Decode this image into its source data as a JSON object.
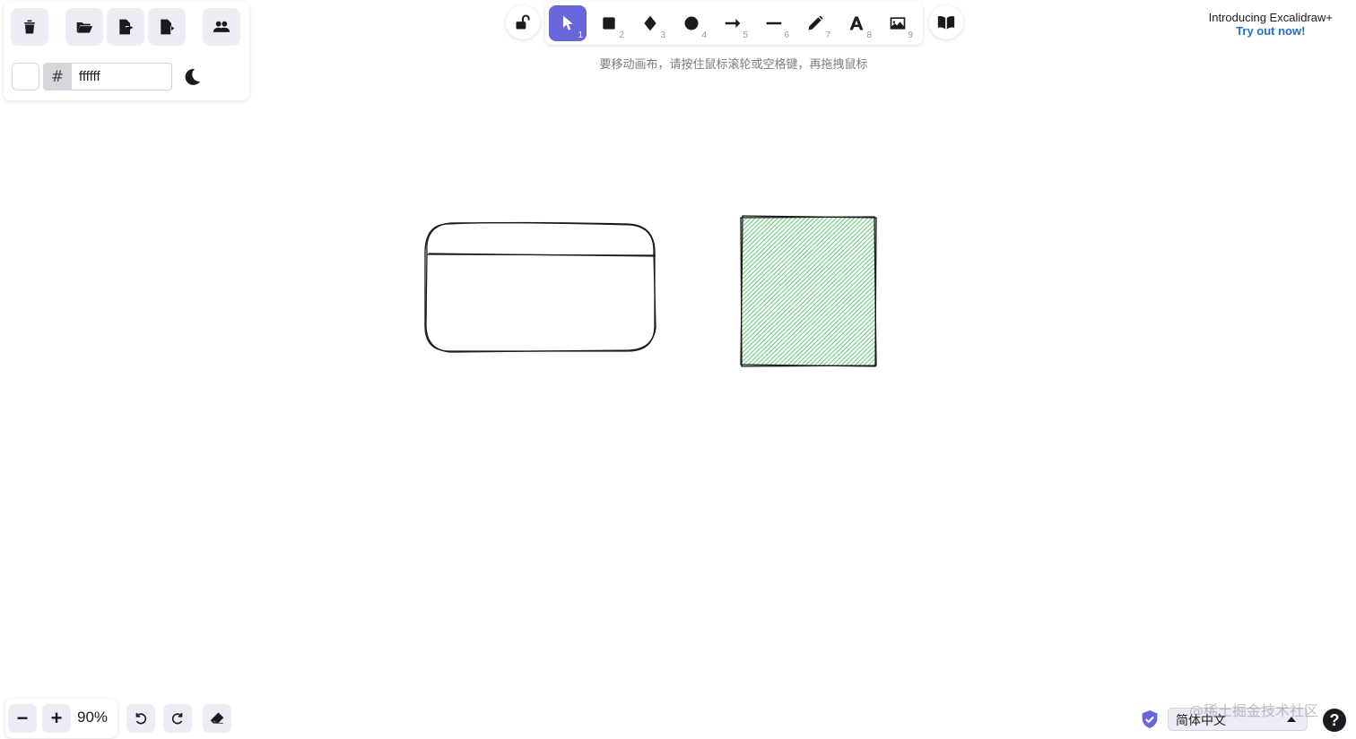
{
  "app_menu": {
    "clear_canvas_icon": "trash-icon",
    "open_icon": "folder-open-icon",
    "export_icon": "file-export-icon",
    "export_image_icon": "file-image-icon",
    "collaborate_icon": "users-icon"
  },
  "canvas_background": {
    "hash_label": "#",
    "hex_value": "ffffff",
    "swatch_color": "#ffffff"
  },
  "toolbar": {
    "tools": [
      {
        "name": "selection",
        "key": "1",
        "active": true
      },
      {
        "name": "rectangle",
        "key": "2"
      },
      {
        "name": "diamond",
        "key": "3"
      },
      {
        "name": "ellipse",
        "key": "4"
      },
      {
        "name": "arrow",
        "key": "5"
      },
      {
        "name": "line",
        "key": "6"
      },
      {
        "name": "draw",
        "key": "7"
      },
      {
        "name": "text",
        "key": "8"
      },
      {
        "name": "image",
        "key": "9"
      }
    ],
    "accent_color": "#6965db"
  },
  "hint": "要移动画布，请按住鼠标滚轮或空格键，再拖拽鼠标",
  "promo": {
    "line1": "Introducing Excalidraw+",
    "line2": "Try out now!"
  },
  "footer": {
    "zoom_out": "−",
    "zoom_in": "+",
    "zoom_level": "90%",
    "language": "简体中文",
    "watermark": "@稀土掘金技术社区",
    "help": "?"
  },
  "canvas_shapes": {
    "hatch_color": "#40c057"
  }
}
